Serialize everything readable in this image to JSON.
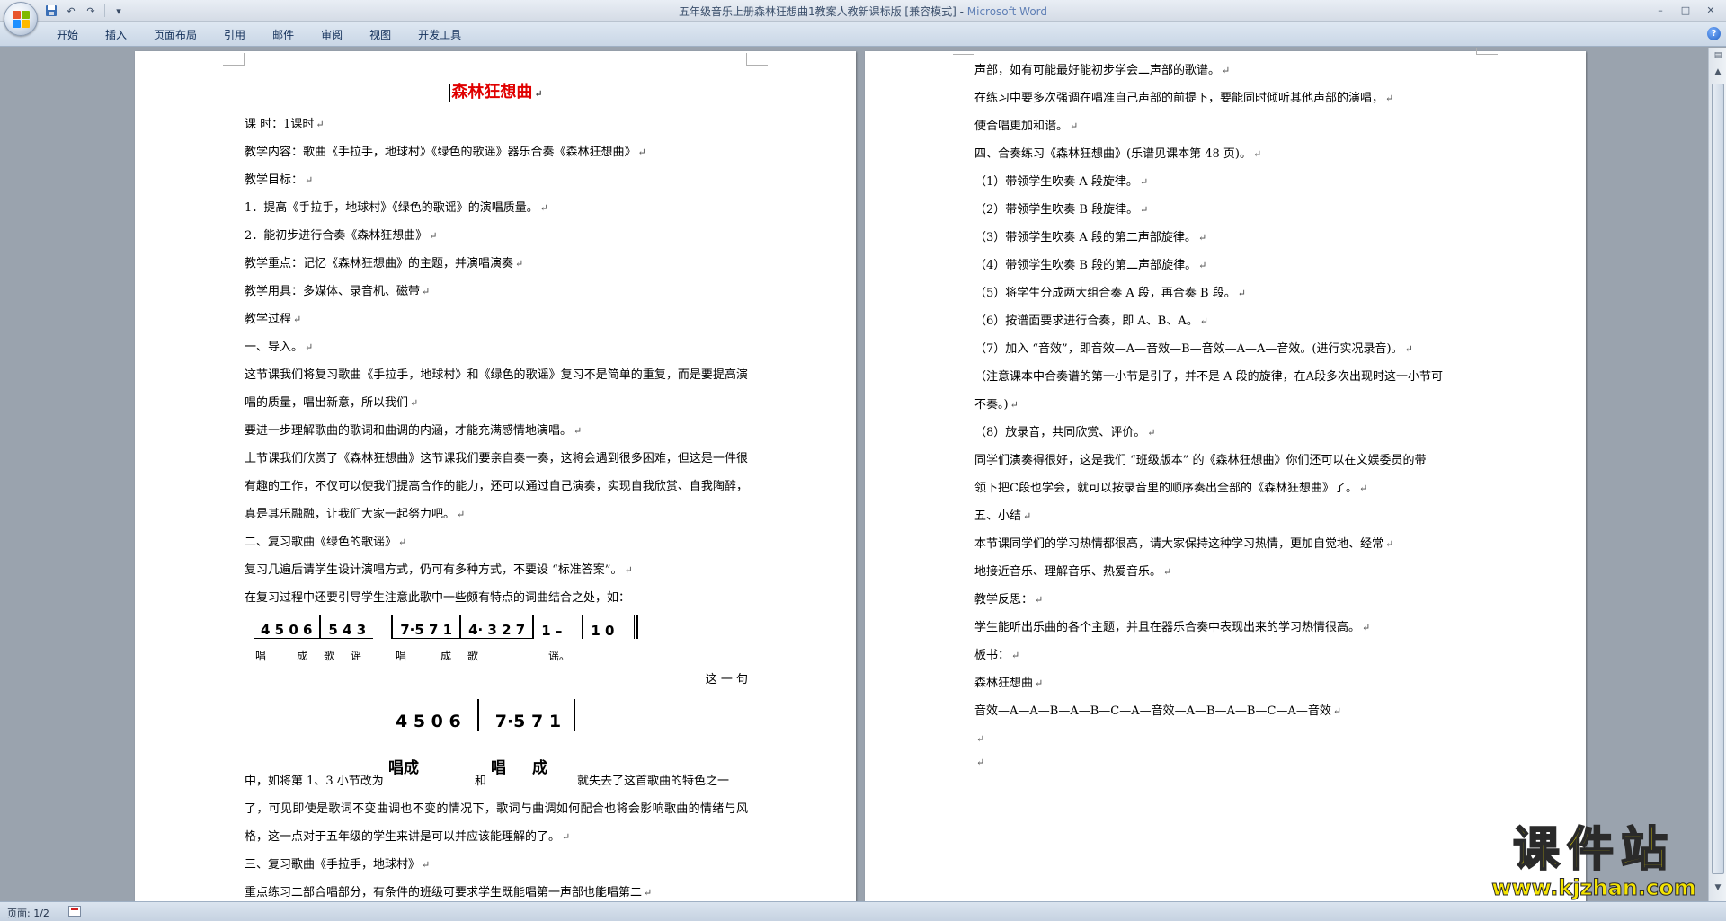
{
  "window": {
    "title": "五年级音乐上册森林狂想曲1教案人教新课标版 [兼容模式] - ",
    "app_name": "Microsoft Word",
    "controls": [
      "–",
      "□",
      "✕"
    ]
  },
  "qat": {
    "save_icon": "save-icon",
    "undo": "↶",
    "redo": "↷",
    "customize": "▾"
  },
  "ribbon": {
    "tabs": [
      "开始",
      "插入",
      "页面布局",
      "引用",
      "邮件",
      "审阅",
      "视图",
      "开发工具"
    ],
    "help": "?"
  },
  "page1": {
    "title": "森林狂想曲",
    "lines": [
      "课      时：1课时",
      "教学内容：歌曲《手拉手，地球村》《绿色的歌谣》器乐合奏《森林狂想曲》",
      "教学目标：",
      "1．提高《手拉手，地球村》《绿色的歌谣》的演唱质量。",
      "2．能初步进行合奏《森林狂想曲》",
      "教学重点：记忆《森林狂想曲》的主题，并演唱演奏",
      "教学用具：多媒体、录音机、磁带",
      "教学过程",
      "一、导入。"
    ],
    "para1": "这节课我们将复习歌曲《手拉手，地球村》和《绿色的歌谣》复习不是简单的重复，而是要提高演唱的质量，唱出新意，所以我们",
    "line_a": "要进一步理解歌曲的歌词和曲调的内涵，才能充满感情地演唱。",
    "para2": "上节课我们欣赏了《森林狂想曲》这节课我们要亲自奏一奏，这将会遇到很多困难，但这是一件很有趣的工作，不仅可以使我们提高合作的能力，还可以通过自己演奏，实现自我欣赏、自我陶醉，真是其乐融融，让我们大家一起努力吧。",
    "line_b": "二、复习歌曲《绿色的歌谣》",
    "line_c": "复习几遍后请学生设计演唱方式，仍可有多种方式，不要设 “标准答案”。",
    "line_d": "在复习过程中还要引导学生注意此歌中一些颇有特点的词曲结合之处，如：",
    "notation": {
      "m1": "4 5 0 6",
      "m2": "5 4 3",
      "m3": "7·5 7 1",
      "m4": "4· 3 2 7",
      "m5": "1   –",
      "m6": "1   0",
      "lyrics": [
        "唱",
        "成",
        "歌",
        "谣",
        "唱",
        "成",
        "歌",
        "谣。"
      ]
    },
    "line_e": "这 一 句",
    "notation2": {
      "m1": "4 5 0 6",
      "m2": "7·5 7 1"
    },
    "mixed": {
      "a": "中，如将第 1、3 小节改为",
      "lyric1": "唱成",
      "b": "和",
      "lyric2a": "唱",
      "lyric2b": "成",
      "c": "就失去了这首歌曲的特色之一"
    },
    "para3": "了，可见即使是歌词不变曲调也不变的情况下，歌词与曲调如何配合也将会影响歌曲的情绪与风格，这一点对于五年级的学生来讲是可以并应该能理解的了。",
    "line_f": "三、复习歌曲《手拉手，地球村》",
    "line_g": "重点练习二部合唱部分，有条件的班级可要求学生既能唱第一声部也能唱第二"
  },
  "page2": {
    "lines": [
      "声部，如有可能最好能初步学会二声部的歌谱。",
      "在练习中要多次强调在唱准自己声部的前提下，要能同时倾听其他声部的演唱，",
      "使合唱更加和谐。",
      "四、合奏练习《森林狂想曲》(乐谱见课本第 48 页)。",
      "（1）带领学生吹奏 A 段旋律。",
      "（2）带领学生吹奏 B 段旋律。",
      "（3）带领学生吹奏 A 段的第二声部旋律。",
      "（4）带领学生吹奏 B 段的第二声部旋律。",
      "（5）将学生分成两大组合奏 A 段，再合奏 B 段。",
      "（6）按谱面要求进行合奏，即 A、B、A。",
      "（7）加入 “音效”，即音效—A—音效—B—音效—A—A—音效。(进行实况录音)。",
      "（注意课本中合奏谱的第一小节是引子，并不是 A 段的旋律，在A段多次出现时这一小节可",
      "不奏。)",
      "（8）放录音，共同欣赏、评价。",
      " 同学们演奏得很好，这是我们 “班级版本” 的《森林狂想曲》你们还可以在文娱委员的带",
      "领下把C段也学会，就可以按录音里的顺序奏出全部的《森林狂想曲》了。",
      "五、小结",
      "本节课同学们的学习热情都很高，请大家保持这种学习热情，更加自觉地、经常",
      "地接近音乐、理解音乐、热爱音乐。",
      "教学反思：",
      "学生能听出乐曲的各个主题，并且在器乐合奏中表现出来的学习热情很高。",
      "板书：",
      "森林狂想曲",
      "音效—A—A—B—A—B—C—A—音效—A—B—A—B—C—A—音效",
      "",
      ""
    ]
  },
  "status": {
    "page": "页面: 1/2"
  },
  "watermark": {
    "title": "课件站",
    "url": "www.kjzhan.com"
  },
  "colors": {
    "title_red": "#e00000",
    "watermark_yellow": "#f5e400"
  }
}
